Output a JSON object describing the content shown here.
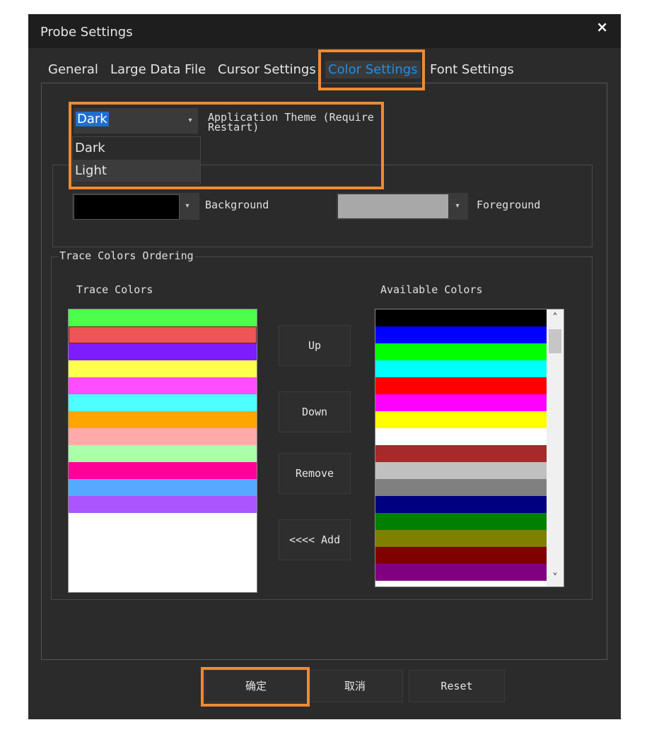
{
  "window": {
    "title": "Probe Settings",
    "close_glyph": "×"
  },
  "tabs": [
    {
      "label": "General"
    },
    {
      "label": "Large Data File"
    },
    {
      "label": "Cursor Settings"
    },
    {
      "label": "Color Settings",
      "active": true
    },
    {
      "label": "Font Settings"
    }
  ],
  "theme": {
    "selected": "Dark",
    "label": "Application Theme (Require",
    "label_overflow": "Restart)",
    "options": [
      "Dark",
      "Light"
    ]
  },
  "colors_row": {
    "background_label": "Background",
    "background_color": "#000000",
    "foreground_label": "Foreground",
    "foreground_color": "#a8a8a8"
  },
  "trace_group": {
    "title": "Trace Colors  Ordering",
    "trace_label": "Trace Colors",
    "available_label": "Available Colors",
    "trace_colors": [
      "#4dff4d",
      "#f05555",
      "#7c1cff",
      "#ffff4d",
      "#ff4dff",
      "#4dffff",
      "#ffa500",
      "#ffaaaa",
      "#aaffaa",
      "#ff0099",
      "#55aaff",
      "#aa55ff"
    ],
    "available_colors": [
      "#000000",
      "#0000ff",
      "#00ff00",
      "#00ffff",
      "#ff0000",
      "#ff00ff",
      "#ffff00",
      "#ffffff",
      "#a52a2a",
      "#c0c0c0",
      "#808080",
      "#000080",
      "#008000",
      "#808000",
      "#800000",
      "#800080"
    ]
  },
  "buttons": {
    "up": "Up",
    "down": "Down",
    "remove": "Remove",
    "add": "<<<< Add",
    "ok": "确定",
    "cancel": "取消",
    "reset": "Reset"
  },
  "icons": {
    "dropdown_arrow": "▾",
    "scroll_up": "˄",
    "scroll_down": "˅"
  },
  "accent": {
    "highlight": "#f08a30",
    "active_tab": "#1e90e8"
  }
}
